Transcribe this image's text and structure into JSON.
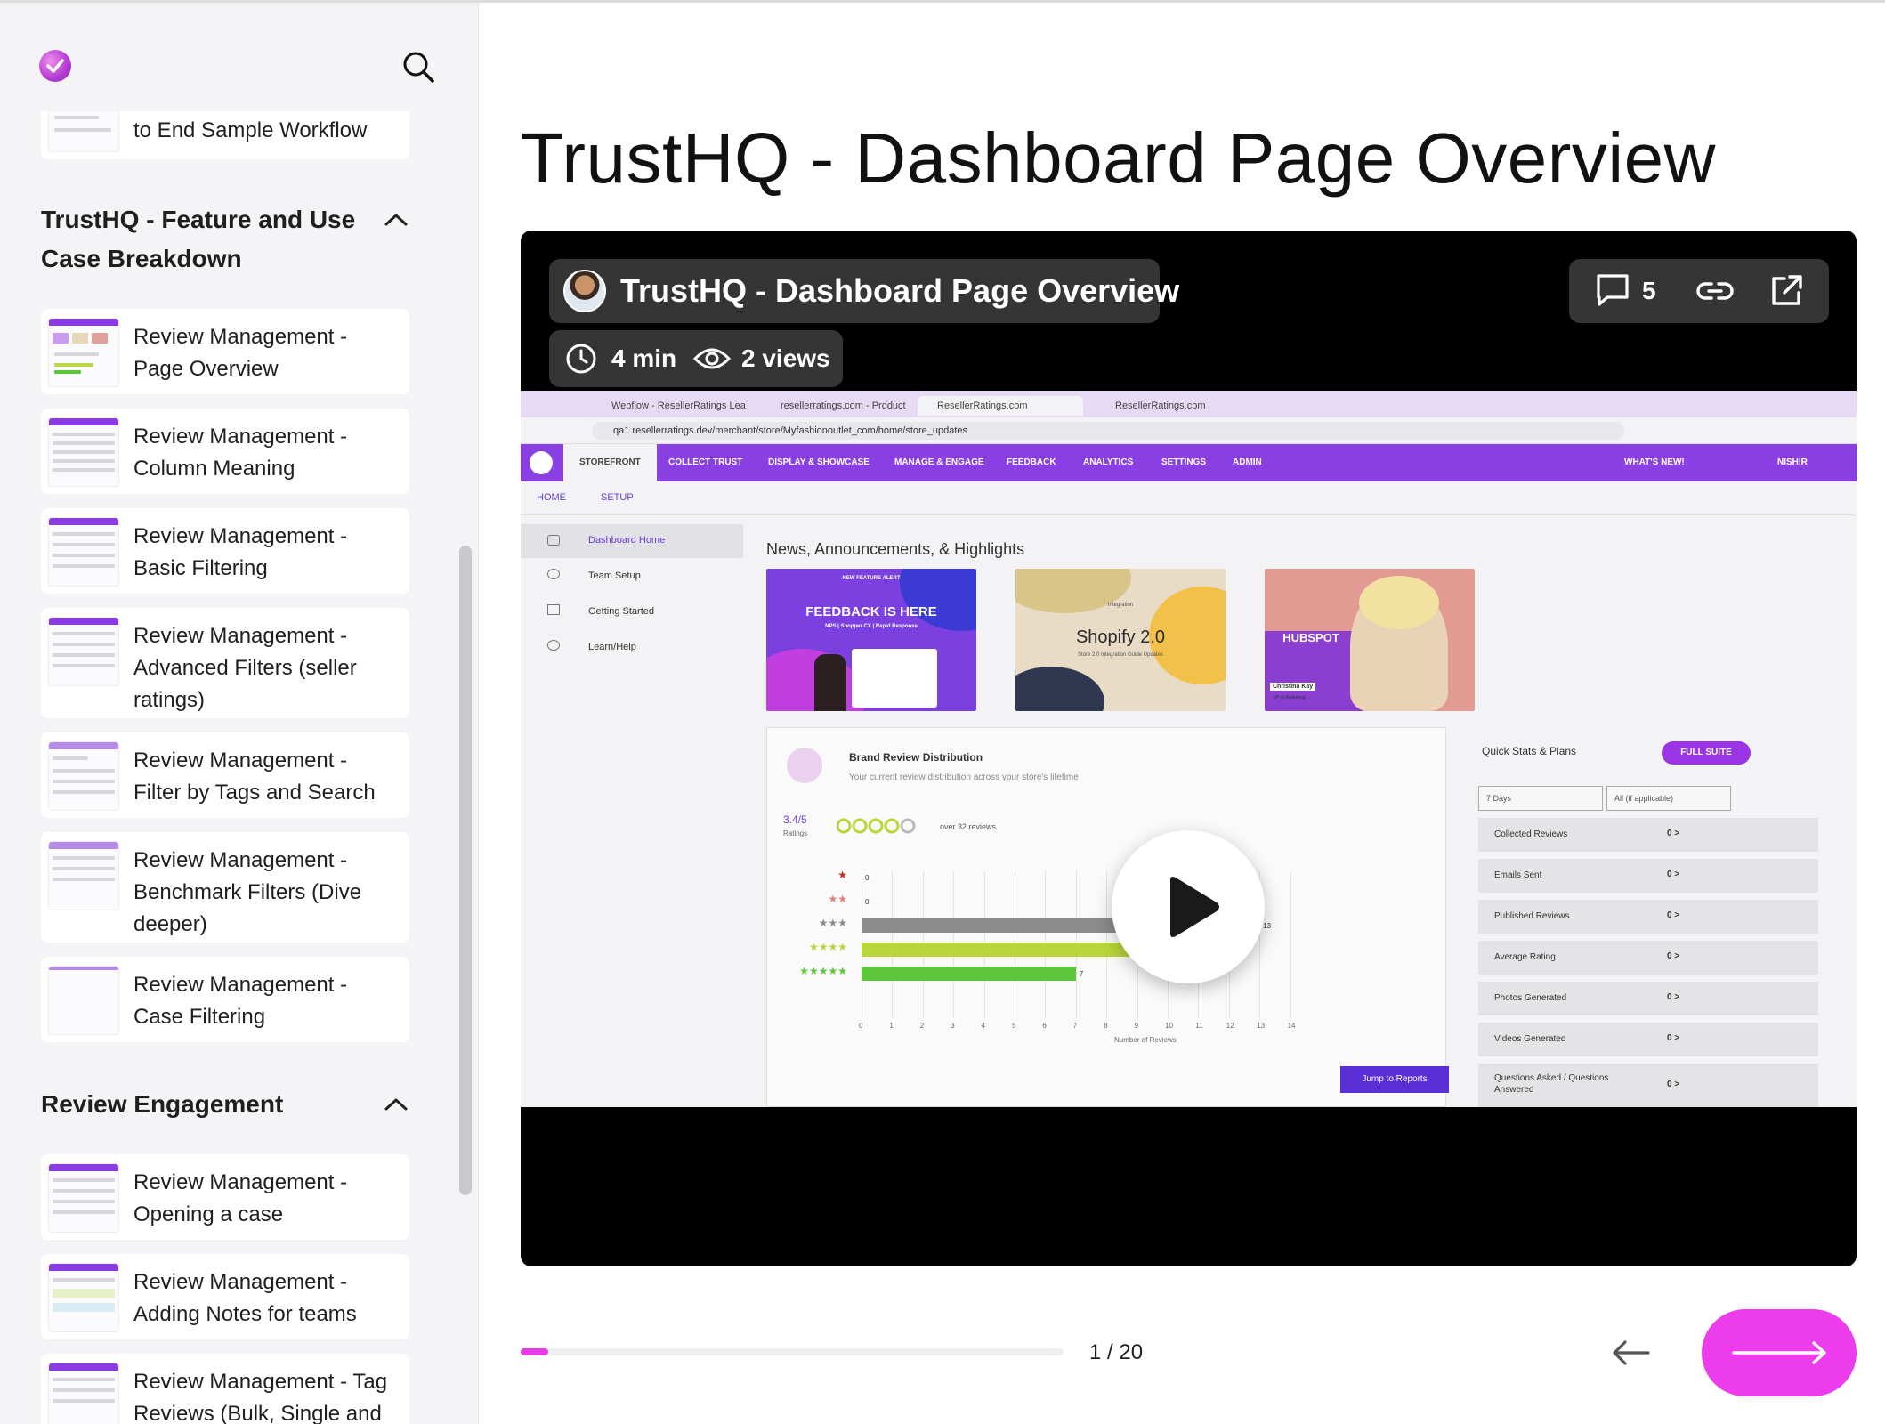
{
  "page": {
    "title": "TrustHQ - Dashboard Page Overview"
  },
  "sidebar": {
    "partial_item": {
      "label": "to End Sample Workflow"
    },
    "sections": [
      {
        "title": "TrustHQ - Feature and Use Case Breakdown",
        "items": [
          {
            "label": "Review Management - Page Overview"
          },
          {
            "label": "Review Management - Column Meaning"
          },
          {
            "label": "Review Management - Basic Filtering"
          },
          {
            "label": "Review Management - Advanced Filters (seller ratings)"
          },
          {
            "label": "Review Management - Filter by Tags and Search"
          },
          {
            "label": "Review Management - Benchmark Filters (Dive deeper)"
          },
          {
            "label": "Review Management - Case Filtering"
          }
        ]
      },
      {
        "title": "Review Engagement",
        "items": [
          {
            "label": "Review Management - Opening a case"
          },
          {
            "label": "Review Management - Adding Notes for teams"
          },
          {
            "label": "Review Management - Tag Reviews (Bulk, Single and"
          }
        ]
      }
    ]
  },
  "video": {
    "title": "TrustHQ - Dashboard Page Overview",
    "duration": "4 min",
    "views": "2 views",
    "comments_count": "5",
    "screen": {
      "tabs": [
        "Webflow - ResellerRatings Lea",
        "resellerratings.com - Product",
        "ResellerRatings.com",
        "ResellerRatings.com"
      ],
      "url": "qa1.resellerratings.dev/merchant/store/Myfashionoutlet_com/home/store_updates",
      "nav": [
        "STOREFRONT",
        "COLLECT TRUST",
        "DISPLAY & SHOWCASE",
        "MANAGE & ENGAGE",
        "FEEDBACK",
        "ANALYTICS",
        "SETTINGS",
        "ADMIN"
      ],
      "whats_new": "WHAT'S NEW!",
      "user": "NISHIR",
      "subnav": [
        "HOME",
        "SETUP"
      ],
      "side": [
        "Dashboard Home",
        "Team Setup",
        "Getting Started",
        "Learn/Help"
      ],
      "news_title": "News, Announcements, & Highlights",
      "cards": {
        "c1_top": "NEW FEATURE ALERT",
        "c1_main": "FEEDBACK IS HERE",
        "c1_sub": "NPS | Shopper CX | Rapid Response",
        "c2_top": "Integration",
        "c2_main": "Shopify 2.0",
        "c2_sub": "Store 2.0 Integration Guide Updates",
        "c3_brand": "HUBSPOT",
        "c3_name": "Christina Kay",
        "c3_role": "VP of Marketing"
      },
      "brand": {
        "title": "Brand Review Distribution",
        "subtitle": "Your current review distribution across your store's lifetime",
        "rating": "3.4/5",
        "rating_label": "Ratings",
        "reviews": "over 32 reviews",
        "bars": [
          {
            "stars": "★",
            "value": 0,
            "color": "#c92a2a"
          },
          {
            "stars": "★★",
            "value": 0,
            "color": "#e08080"
          },
          {
            "stars": "★★★",
            "value": 13,
            "color": "#8c8c8c"
          },
          {
            "stars": "★★★★",
            "value": 11,
            "color": "#b8d63a"
          },
          {
            "stars": "★★★★★",
            "value": 7,
            "color": "#5cc63a"
          }
        ],
        "axis": [
          "0",
          "1",
          "2",
          "3",
          "4",
          "5",
          "6",
          "7",
          "8",
          "9",
          "10",
          "11",
          "12",
          "13",
          "14"
        ],
        "axis_title": "Number of Reviews",
        "jump": "Jump to Reports"
      },
      "stats": {
        "title": "Quick Stats & Plans",
        "plan": "FULL SUITE",
        "period": "7 Days",
        "scope": "All (if applicable)",
        "rows": [
          {
            "label": "Collected Reviews",
            "value": "0 >"
          },
          {
            "label": "Emails Sent",
            "value": "0 >"
          },
          {
            "label": "Published Reviews",
            "value": "0 >"
          },
          {
            "label": "Average Rating",
            "value": "0 >"
          },
          {
            "label": "Photos Generated",
            "value": "0 >"
          },
          {
            "label": "Videos Generated",
            "value": "0 >"
          },
          {
            "label": "Questions Asked / Questions Answered",
            "value": "0 >"
          }
        ]
      }
    }
  },
  "footer": {
    "page_count": "1 / 20",
    "progress": 0.05
  },
  "colors": {
    "accent": "#ec3cec",
    "nav_purple": "#8a3fe2"
  }
}
